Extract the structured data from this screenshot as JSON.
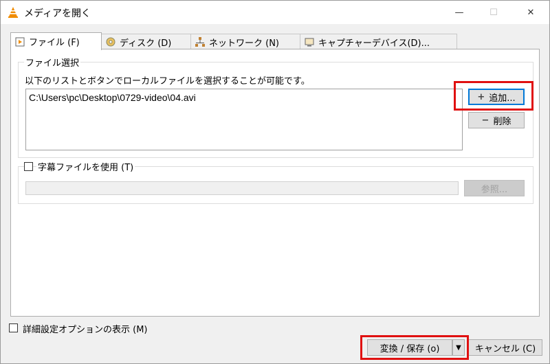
{
  "window": {
    "title": "メディアを開く",
    "minimize_glyph": "—",
    "maximize_glyph": "☐",
    "close_glyph": "✕"
  },
  "tabs": [
    {
      "label": "ファイル (F)",
      "icon": "file-play-icon",
      "active": true
    },
    {
      "label": "ディスク (D)",
      "icon": "disc-icon",
      "active": false
    },
    {
      "label": "ネットワーク (N)",
      "icon": "network-icon",
      "active": false
    },
    {
      "label": "キャプチャーデバイス(D)...",
      "icon": "capture-device-icon",
      "active": false
    }
  ],
  "file_selection": {
    "legend": "ファイル選択",
    "description": "以下のリストとボタンでローカルファイルを選択することが可能です。",
    "files": [
      "C:\\Users\\pc\\Desktop\\0729-video\\04.avi"
    ],
    "add_button": "追加...",
    "remove_button": "削除"
  },
  "subtitle": {
    "checkbox_label": "字幕ファイルを使用 (T)",
    "checked": false,
    "browse_button": "参照..."
  },
  "options": {
    "advanced_label": "詳細設定オプションの表示 (M)",
    "checked": false
  },
  "footer": {
    "convert_button": "変換 / 保存 (o)",
    "dropdown_glyph": "▼",
    "cancel_button": "キャンセル (C)"
  },
  "colors": {
    "highlight": "#e01010",
    "focus": "#0078d7",
    "vlc_orange": "#f08c00"
  }
}
